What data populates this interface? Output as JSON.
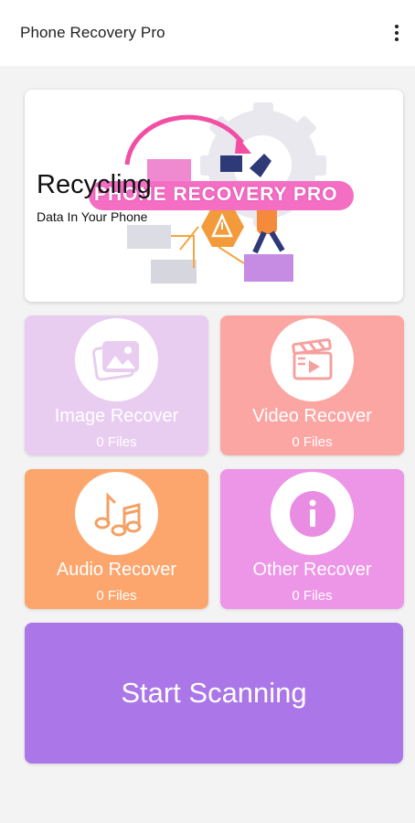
{
  "app_bar": {
    "title": "Phone Recovery Pro",
    "menu_icon": "more-vert-icon"
  },
  "banner": {
    "title": "Recycling",
    "subtitle": "Data In Your Phone",
    "logo_text": "PHONE RECOVERY PRO"
  },
  "tiles": [
    {
      "label": "Image Recover",
      "count": "0 Files",
      "icon": "image-icon",
      "color": "#e8cdf1",
      "icon_color": "#e8cdf1"
    },
    {
      "label": "Video Recover",
      "count": "0 Files",
      "icon": "clapperboard-icon",
      "color": "#fca6a4",
      "icon_color": "#f6a09e"
    },
    {
      "label": "Audio Recover",
      "count": "0 Files",
      "icon": "music-note-icon",
      "color": "#fca66e",
      "icon_color": "#f5a064"
    },
    {
      "label": "Other Recover",
      "count": "0 Files",
      "icon": "info-icon",
      "color": "#ed95e6",
      "icon_color": "#e98de3"
    }
  ],
  "scan_button": {
    "label": "Start Scanning",
    "color": "#ab76e8"
  }
}
